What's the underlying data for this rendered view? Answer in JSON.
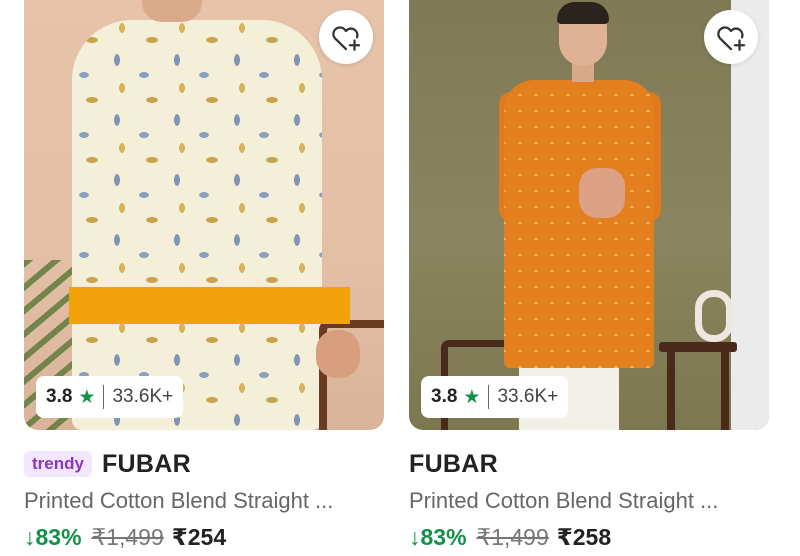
{
  "products": [
    {
      "rating": "3.8",
      "rating_count": "33.6K+",
      "tag": "trendy",
      "brand": "FUBAR",
      "title": "Printed Cotton Blend Straight ...",
      "discount": "↓83%",
      "mrp": "₹1,499",
      "price": "₹254"
    },
    {
      "rating": "3.8",
      "rating_count": "33.6K+",
      "brand": "FUBAR",
      "title": "Printed Cotton Blend Straight ...",
      "discount": "↓83%",
      "mrp": "₹1,499",
      "price": "₹258"
    }
  ],
  "icons": {
    "wishlist": "heart-plus-icon",
    "rating_star": "star-icon"
  },
  "colors": {
    "discount_green": "#14904a",
    "star_green": "#14904a",
    "tag_purple": "#8a36c2",
    "tag_bg": "#f3e6ff"
  }
}
